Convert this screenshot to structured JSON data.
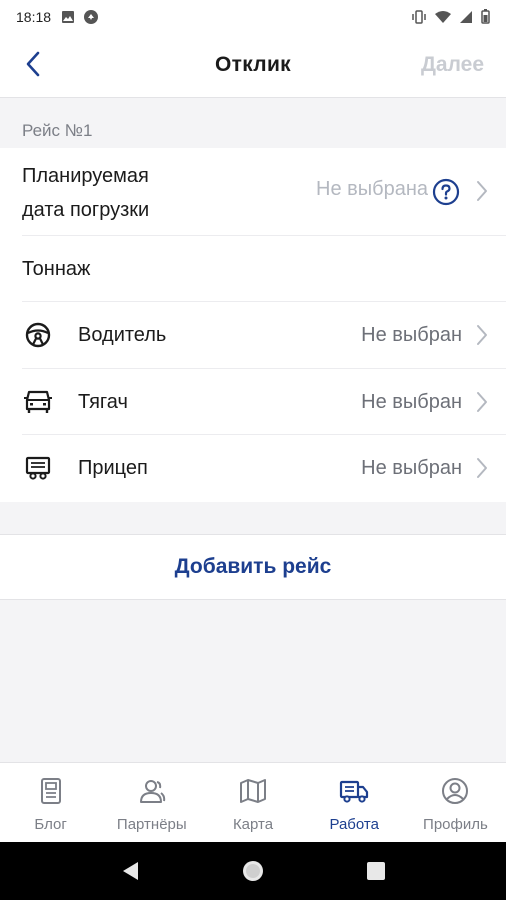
{
  "status_bar": {
    "time": "18:18",
    "left_icons": [
      "image-icon",
      "app-notification-icon"
    ],
    "right_icons": [
      "vibrate-icon",
      "wifi-icon",
      "signal-icon",
      "battery-icon"
    ]
  },
  "header": {
    "title": "Отклик",
    "next_label": "Далее",
    "back_icon": "chevron-left-icon"
  },
  "trip": {
    "section_label": "Рейс №1",
    "loading_date": {
      "label_line1": "Планируемая",
      "label_line2": "дата погрузки",
      "value": "Не выбрана"
    },
    "tonnage": {
      "label": "Тоннаж"
    },
    "driver": {
      "label": "Водитель",
      "value": "Не выбран",
      "icon": "steering-wheel-icon"
    },
    "tractor": {
      "label": "Тягач",
      "value": "Не выбран",
      "icon": "truck-front-icon"
    },
    "trailer": {
      "label": "Прицеп",
      "value": "Не выбран",
      "icon": "trailer-icon"
    }
  },
  "add_trip_label": "Добавить рейс",
  "tabs": [
    {
      "label": "Блог",
      "icon": "document-icon",
      "active": false
    },
    {
      "label": "Партнёры",
      "icon": "partners-icon",
      "active": false
    },
    {
      "label": "Карта",
      "icon": "map-icon",
      "active": false
    },
    {
      "label": "Работа",
      "icon": "truck-icon",
      "active": true
    },
    {
      "label": "Профиль",
      "icon": "profile-icon",
      "active": false
    }
  ],
  "colors": {
    "accent": "#1d3f8f",
    "muted_text": "#b4b8c0",
    "background": "#f4f4f6"
  }
}
